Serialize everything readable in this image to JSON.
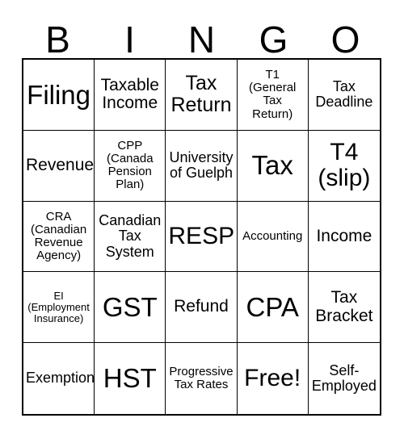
{
  "card": {
    "header_letters": [
      "B",
      "I",
      "N",
      "G",
      "O"
    ],
    "columns": 5,
    "rows": 5,
    "border_color": "#000000",
    "background_color": "#ffffff",
    "text_color": "#000000",
    "cells": [
      {
        "text": "Filing",
        "size": "xxl"
      },
      {
        "text": "Taxable\nIncome",
        "size": "md"
      },
      {
        "text": "Tax\nReturn",
        "size": "lg"
      },
      {
        "text": "T1\n(General\nTax\nReturn)",
        "size": "xs"
      },
      {
        "text": "Tax\nDeadline",
        "size": "sm"
      },
      {
        "text": "Revenue",
        "size": "md"
      },
      {
        "text": "CPP\n(Canada\nPension\nPlan)",
        "size": "xs"
      },
      {
        "text": "University\nof Guelph",
        "size": "sm"
      },
      {
        "text": "Tax",
        "size": "xxl"
      },
      {
        "text": "T4\n(slip)",
        "size": "xl"
      },
      {
        "text": "CRA\n(Canadian\nRevenue\nAgency)",
        "size": "xs"
      },
      {
        "text": "Canadian\nTax\nSystem",
        "size": "sm"
      },
      {
        "text": "RESP",
        "size": "xl"
      },
      {
        "text": "Accounting",
        "size": "xs"
      },
      {
        "text": "Income",
        "size": "md"
      },
      {
        "text": "EI\n(Employment\nInsurance)",
        "size": "xxs"
      },
      {
        "text": "GST",
        "size": "xxl"
      },
      {
        "text": "Refund",
        "size": "md"
      },
      {
        "text": "CPA",
        "size": "xxl"
      },
      {
        "text": "Tax\nBracket",
        "size": "md"
      },
      {
        "text": "Exemption",
        "size": "sm"
      },
      {
        "text": "HST",
        "size": "xxl"
      },
      {
        "text": "Progressive\nTax Rates",
        "size": "xs"
      },
      {
        "text": "Free!",
        "size": "xl"
      },
      {
        "text": "Self-\nEmployed",
        "size": "sm"
      }
    ]
  }
}
